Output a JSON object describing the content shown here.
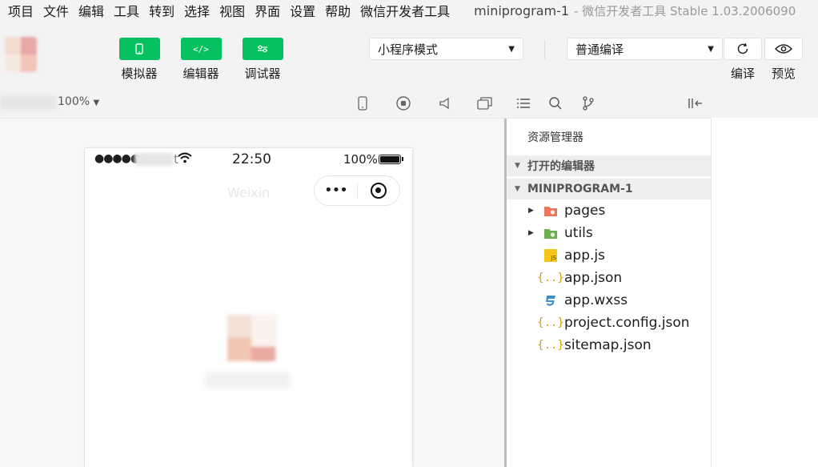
{
  "menubar": {
    "items": [
      "项目",
      "文件",
      "编辑",
      "工具",
      "转到",
      "选择",
      "视图",
      "界面",
      "设置",
      "帮助",
      "微信开发者工具"
    ],
    "window_title": "miniprogram-1",
    "window_subtitle": "- 微信开发者工具 Stable 1.03.2006090"
  },
  "toolbar": {
    "simulator_label": "模拟器",
    "editor_label": "编辑器",
    "debugger_label": "调试器",
    "editor_glyph": "</>",
    "mode_select": "小程序模式",
    "compile_select": "普通编译",
    "compile_label": "编译",
    "preview_label": "预览",
    "accent_color": "#07c160"
  },
  "simulator": {
    "zoom": "100%",
    "status": {
      "signal": "●●●●●",
      "carrier_partial": "V",
      "carrier_end": "t",
      "time": "22:50",
      "battery": "100%"
    },
    "nav_title": "Weixin",
    "capsule_dots": "•••"
  },
  "explorer": {
    "title": "资源管理器",
    "open_editors": "打开的编辑器",
    "project": "MINIPROGRAM-1",
    "files": [
      {
        "name": "pages",
        "icon": "folder-orange-icon",
        "folder": true
      },
      {
        "name": "utils",
        "icon": "folder-green-icon",
        "folder": true
      },
      {
        "name": "app.js",
        "icon": "js-file-icon",
        "folder": false
      },
      {
        "name": "app.json",
        "icon": "json-file-icon",
        "folder": false
      },
      {
        "name": "app.wxss",
        "icon": "css-file-icon",
        "folder": false
      },
      {
        "name": "project.config.json",
        "icon": "json-file-icon",
        "folder": false
      },
      {
        "name": "sitemap.json",
        "icon": "json-file-icon",
        "folder": false
      }
    ]
  }
}
